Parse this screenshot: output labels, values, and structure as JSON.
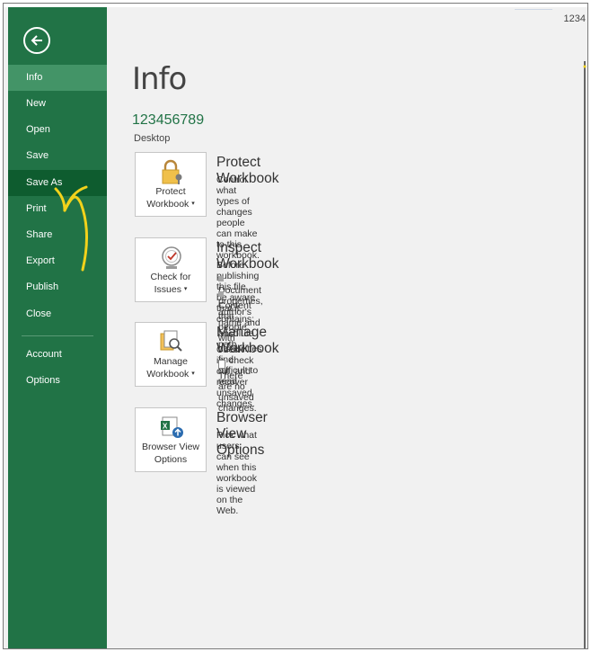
{
  "corner_text": "1234",
  "sidebar": {
    "back_label": "Back",
    "items": [
      {
        "label": "Info"
      },
      {
        "label": "New"
      },
      {
        "label": "Open"
      },
      {
        "label": "Save"
      },
      {
        "label": "Save As"
      },
      {
        "label": "Print"
      },
      {
        "label": "Share"
      },
      {
        "label": "Export"
      },
      {
        "label": "Publish"
      },
      {
        "label": "Close"
      },
      {
        "label": "Account"
      },
      {
        "label": "Options"
      }
    ]
  },
  "main": {
    "title": "Info",
    "file_name": "123456789",
    "file_location": "Desktop",
    "sections": [
      {
        "tile_line1": "Protect",
        "tile_line2": "Workbook",
        "icon": "lock-icon",
        "title": "Protect Workbook",
        "desc": "Control what types of changes people can make to this workbook."
      },
      {
        "tile_line1": "Check for",
        "tile_line2": "Issues",
        "icon": "inspect-icon",
        "title": "Inspect Workbook",
        "desc": "Before publishing this file, be aware that it contains:",
        "bullets": [
          "Document properties, author's name and absolute path",
          "Content that people with disabilities find difficult to read"
        ]
      },
      {
        "tile_line1": "Manage",
        "tile_line2": "Workbook",
        "icon": "manage-workbook-icon",
        "title": "Manage Workbook",
        "desc": "Check in, check out, and recover unsaved changes.",
        "note": "There are no unsaved changes."
      },
      {
        "tile_line1": "Browser View",
        "tile_line2": "Options",
        "icon": "browser-view-icon",
        "title": "Browser View Options",
        "desc": "Pick what users can see when this workbook is viewed on the Web."
      }
    ]
  },
  "colors": {
    "sidebar": "#217346",
    "active_item": "#439467",
    "saveas_item": "#0e5c2f",
    "accent_text": "#217346",
    "annotation_arrow": "#f2d21b"
  }
}
